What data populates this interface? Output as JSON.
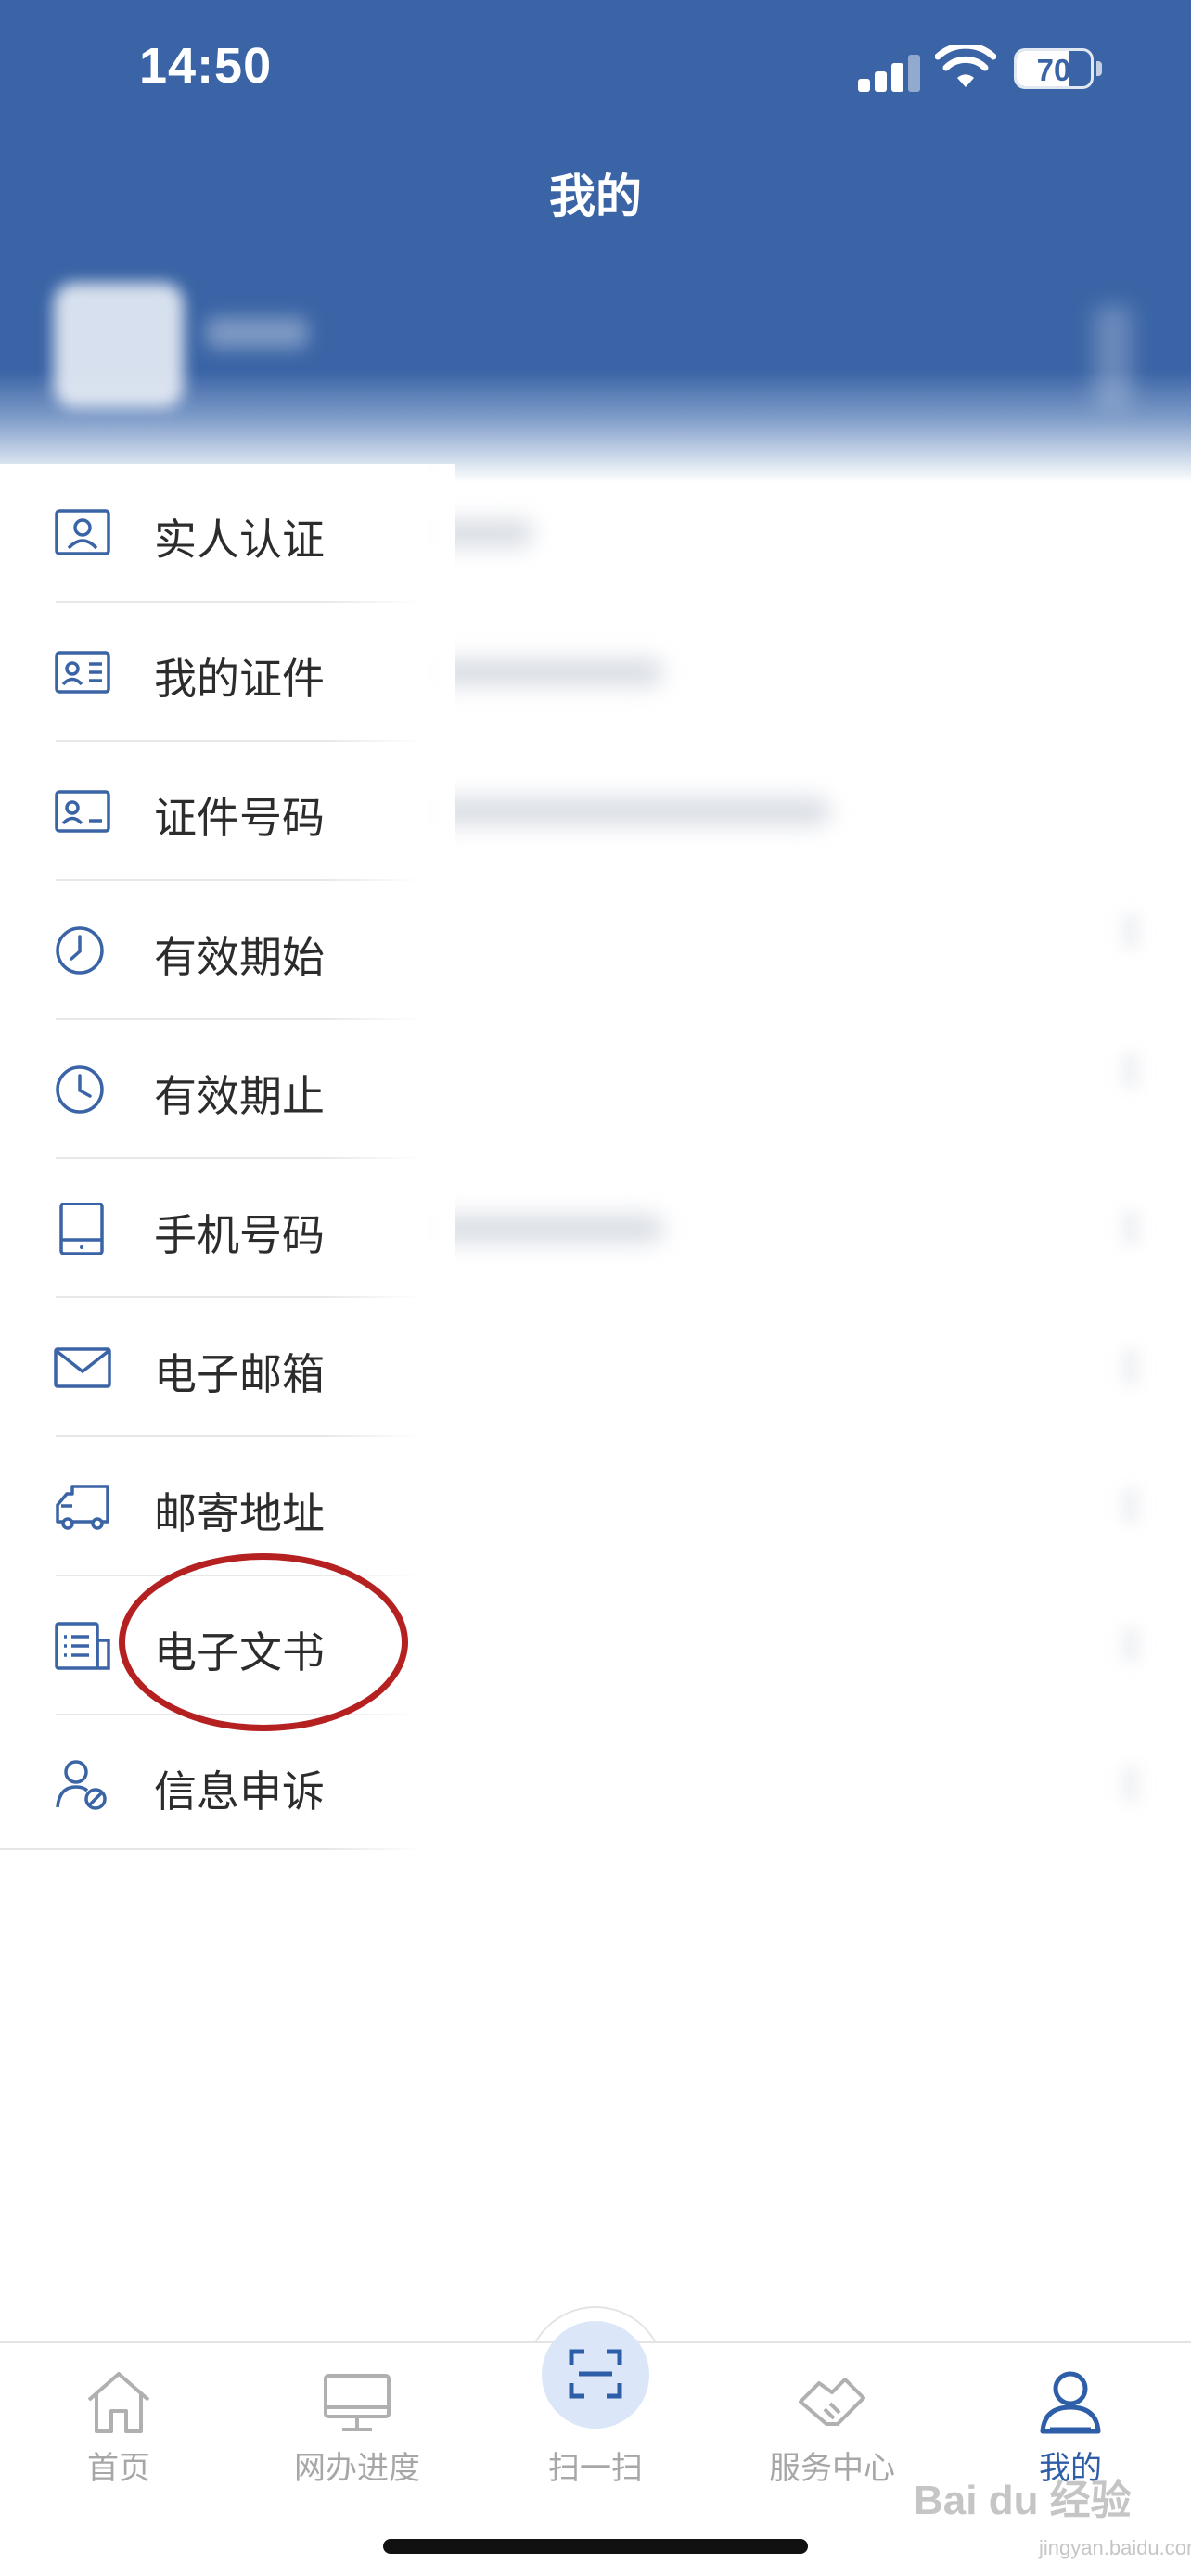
{
  "status_bar": {
    "time": "14:50",
    "battery": "70"
  },
  "header": {
    "title": "我的"
  },
  "menu": {
    "items": [
      {
        "label": "实人认证",
        "icon": "id-person-icon"
      },
      {
        "label": "我的证件",
        "icon": "id-card-icon"
      },
      {
        "label": "证件号码",
        "icon": "id-number-icon"
      },
      {
        "label": "有效期始",
        "icon": "clock-icon"
      },
      {
        "label": "有效期止",
        "icon": "clock-icon"
      },
      {
        "label": "手机号码",
        "icon": "phone-icon"
      },
      {
        "label": "电子邮箱",
        "icon": "mail-icon"
      },
      {
        "label": "邮寄地址",
        "icon": "truck-icon"
      },
      {
        "label": "电子文书",
        "icon": "document-icon"
      },
      {
        "label": "信息申诉",
        "icon": "user-block-icon"
      }
    ]
  },
  "tabbar": {
    "tabs": [
      {
        "label": "首页",
        "icon": "home-icon"
      },
      {
        "label": "网办进度",
        "icon": "monitor-icon"
      },
      {
        "label": "扫一扫",
        "icon": "scan-icon"
      },
      {
        "label": "服务中心",
        "icon": "handshake-icon"
      },
      {
        "label": "我的",
        "icon": "user-icon"
      }
    ],
    "active": "我的"
  },
  "watermark": {
    "text": "Bai du 经验",
    "sub": "jingyan.baidu.com"
  },
  "colors": {
    "primary": "#3a64a5",
    "active_tab": "#2f5ea8",
    "annotation": "#b52020"
  }
}
